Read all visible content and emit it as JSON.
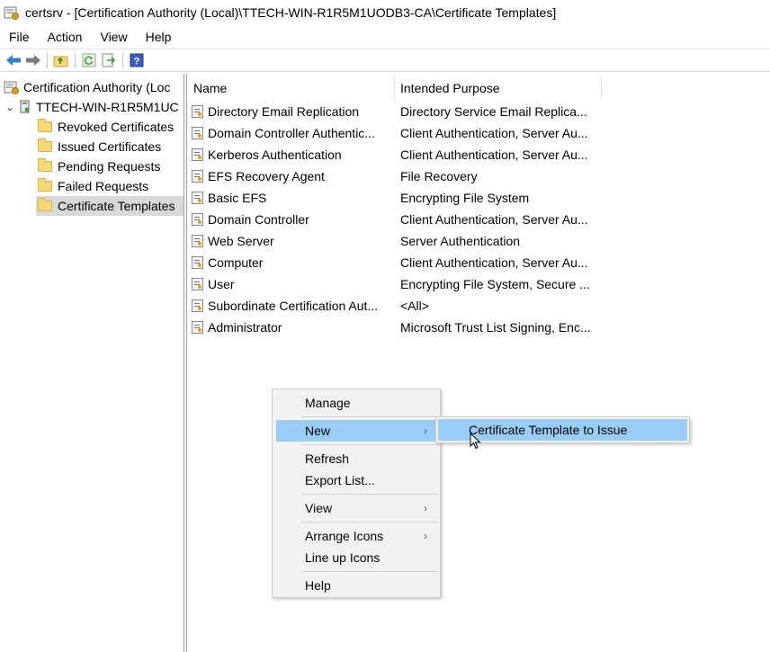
{
  "window": {
    "title": "certsrv - [Certification Authority (Local)\\TTECH-WIN-R1R5M1UODB3-CA\\Certificate Templates]"
  },
  "menubar": [
    "File",
    "Action",
    "View",
    "Help"
  ],
  "toolbar": {
    "buttons": [
      "back-icon",
      "forward-icon",
      "up-folder-icon",
      "refresh-icon",
      "export-list-icon",
      "help-icon"
    ]
  },
  "tree": {
    "root_label": "Certification Authority (Loc",
    "ca_label": "TTECH-WIN-R1R5M1UC",
    "expander": "⌄",
    "items": [
      {
        "label": "Revoked Certificates"
      },
      {
        "label": "Issued Certificates"
      },
      {
        "label": "Pending Requests"
      },
      {
        "label": "Failed Requests"
      },
      {
        "label": "Certificate Templates",
        "selected": true
      }
    ]
  },
  "list": {
    "columns": [
      "Name",
      "Intended Purpose"
    ],
    "rows": [
      {
        "name": "Directory Email Replication",
        "purpose": "Directory Service Email Replica..."
      },
      {
        "name": "Domain Controller Authentic...",
        "purpose": "Client Authentication, Server Au..."
      },
      {
        "name": "Kerberos Authentication",
        "purpose": "Client Authentication, Server Au..."
      },
      {
        "name": "EFS Recovery Agent",
        "purpose": "File Recovery"
      },
      {
        "name": "Basic EFS",
        "purpose": "Encrypting File System"
      },
      {
        "name": "Domain Controller",
        "purpose": "Client Authentication, Server Au..."
      },
      {
        "name": "Web Server",
        "purpose": "Server Authentication"
      },
      {
        "name": "Computer",
        "purpose": "Client Authentication, Server Au..."
      },
      {
        "name": "User",
        "purpose": "Encrypting File System, Secure ..."
      },
      {
        "name": "Subordinate Certification Aut...",
        "purpose": "<All>"
      },
      {
        "name": "Administrator",
        "purpose": "Microsoft Trust List Signing, Enc..."
      }
    ]
  },
  "context_menu": {
    "manage": "Manage",
    "new": "New",
    "refresh": "Refresh",
    "export_list": "Export List...",
    "view": "View",
    "arrange_icons": "Arrange Icons",
    "line_up_icons": "Line up Icons",
    "help": "Help",
    "submenu_arrow": "›"
  },
  "submenu": {
    "item": "Certificate Template to Issue"
  },
  "colors": {
    "highlight": "#99ccf7",
    "menu_bg": "#f2f2f2",
    "selected_tree": "#d9d9d9",
    "folder": "#f6d77a"
  }
}
